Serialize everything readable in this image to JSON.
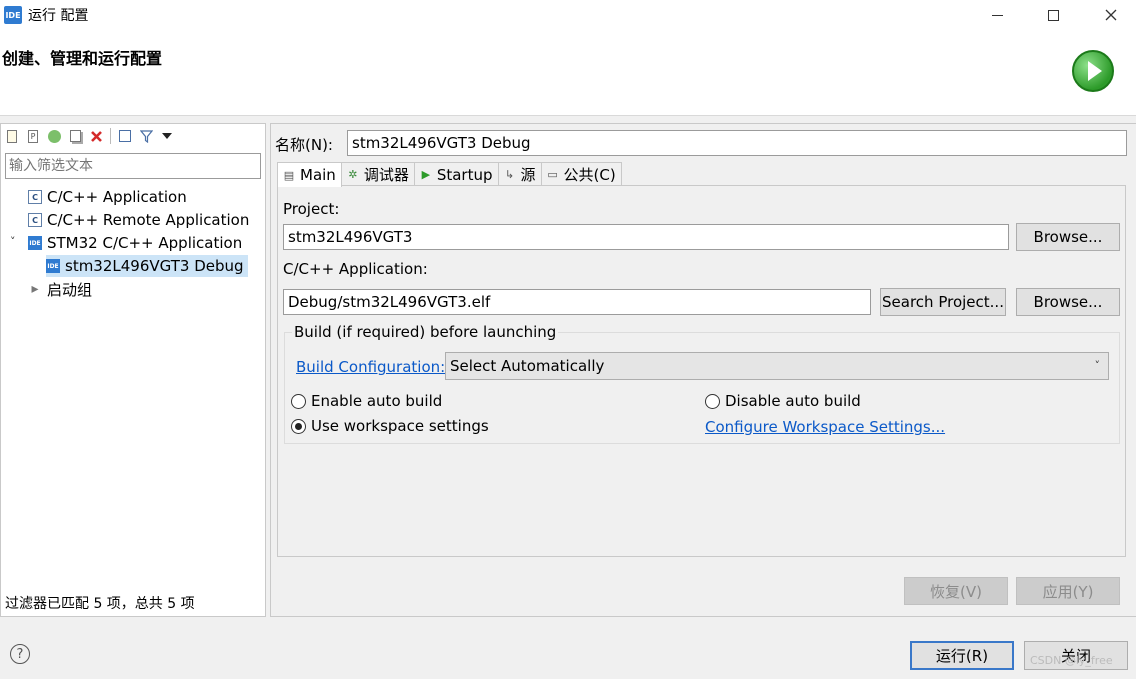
{
  "window": {
    "title": "运行 配置",
    "logo_text": "IDE"
  },
  "header": {
    "heading": "创建、管理和运行配置"
  },
  "left": {
    "filter_placeholder": "输入筛选文本",
    "tree": [
      {
        "label": "C/C++ Application",
        "icon": "c-app-icon"
      },
      {
        "label": "C/C++ Remote Application",
        "icon": "c-app-icon"
      },
      {
        "label": "STM32 C/C++ Application",
        "icon": "ide-icon"
      },
      {
        "label": "stm32L496VGT3 Debug",
        "icon": "ide-icon"
      },
      {
        "label": "启动组",
        "icon": "launch-group-icon"
      }
    ],
    "status": "过滤器已匹配 5 项，总共 5 项"
  },
  "right": {
    "name_label": "名称(N):",
    "name_value": "stm32L496VGT3 Debug",
    "tabs": [
      {
        "label": "Main",
        "icon": "document-icon"
      },
      {
        "label": "调试器",
        "icon": "debugger-icon"
      },
      {
        "label": "Startup",
        "icon": "play-icon"
      },
      {
        "label": "源",
        "icon": "source-icon"
      },
      {
        "label": "公共(C)",
        "icon": "common-icon"
      }
    ],
    "project_label": "Project:",
    "project_value": "stm32L496VGT3",
    "browse_label": "Browse...",
    "app_label": "C/C++ Application:",
    "app_value": "Debug/stm32L496VGT3.elf",
    "search_project_label": "Search Project...",
    "build_group_title": "Build (if required) before launching",
    "build_config_link": "Build Configuration:",
    "build_config_value": "Select Automatically",
    "enable_auto_build": "Enable auto build",
    "disable_auto_build": "Disable auto build",
    "use_workspace_settings": "Use workspace settings",
    "configure_workspace_link": "Configure Workspace Settings...",
    "selected_radio": "use_workspace_settings",
    "revert_label": "恢复(V)",
    "apply_label": "应用(Y)"
  },
  "footer": {
    "run_label": "运行(R)",
    "close_label": "关闭",
    "watermark": "CSDN @ly_free"
  }
}
